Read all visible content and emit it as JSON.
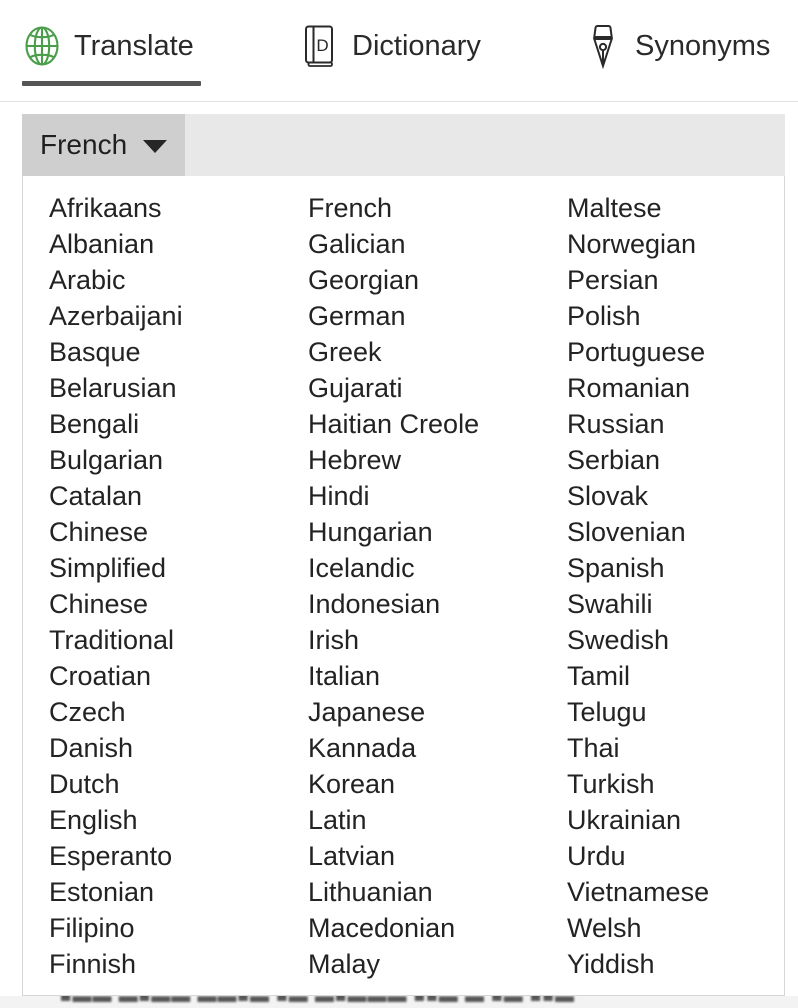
{
  "tabs": [
    {
      "label": "Translate",
      "icon": "globe-icon",
      "active": true,
      "icon_color": "#4a9e4a"
    },
    {
      "label": "Dictionary",
      "icon": "book-icon",
      "active": false,
      "icon_color": "#2a2a2a"
    },
    {
      "label": "Synonyms",
      "icon": "pen-nib-icon",
      "active": false,
      "icon_color": "#2a2a2a"
    }
  ],
  "language_select": {
    "selected": "French",
    "caret_icon": "chevron-down-icon",
    "expanded": true
  },
  "language_columns": [
    [
      "Afrikaans",
      "Albanian",
      "Arabic",
      "Azerbaijani",
      "Basque",
      "Belarusian",
      "Bengali",
      "Bulgarian",
      "Catalan",
      "Chinese",
      "Simplified",
      "Chinese",
      "Traditional",
      "Croatian",
      "Czech",
      "Danish",
      "Dutch",
      "English",
      "Esperanto",
      "Estonian",
      "Filipino",
      "Finnish"
    ],
    [
      "French",
      "Galician",
      "Georgian",
      "German",
      "Greek",
      "Gujarati",
      "Haitian Creole",
      "Hebrew",
      "Hindi",
      "Hungarian",
      "Icelandic",
      "Indonesian",
      "Irish",
      "Italian",
      "Japanese",
      "Kannada",
      "Korean",
      "Latin",
      "Latvian",
      "Lithuanian",
      "Macedonian",
      "Malay"
    ],
    [
      "Maltese",
      "Norwegian",
      "Persian",
      "Polish",
      "Portuguese",
      "Romanian",
      "Russian",
      "Serbian",
      "Slovak",
      "Slovenian",
      "Spanish",
      "Swahili",
      "Swedish",
      "Tamil",
      "Telugu",
      "Thai",
      "Turkish",
      "Ukrainian",
      "Urdu",
      "Vietnamese",
      "Welsh",
      "Yiddish"
    ]
  ],
  "background_bleed": {
    "text": "■▬▬ ▬■▬▬ ▬▬■▬ ■▬ ▬■▬▬▬ ■■▬ ▬ ■▬ ■■▬"
  },
  "colors": {
    "accent_green": "#4a9e4a",
    "text": "#232323",
    "strip_bg": "#e8e8e8",
    "button_bg": "#cfcfcf",
    "underline": "#555555",
    "panel_border": "#d6d6d6"
  }
}
